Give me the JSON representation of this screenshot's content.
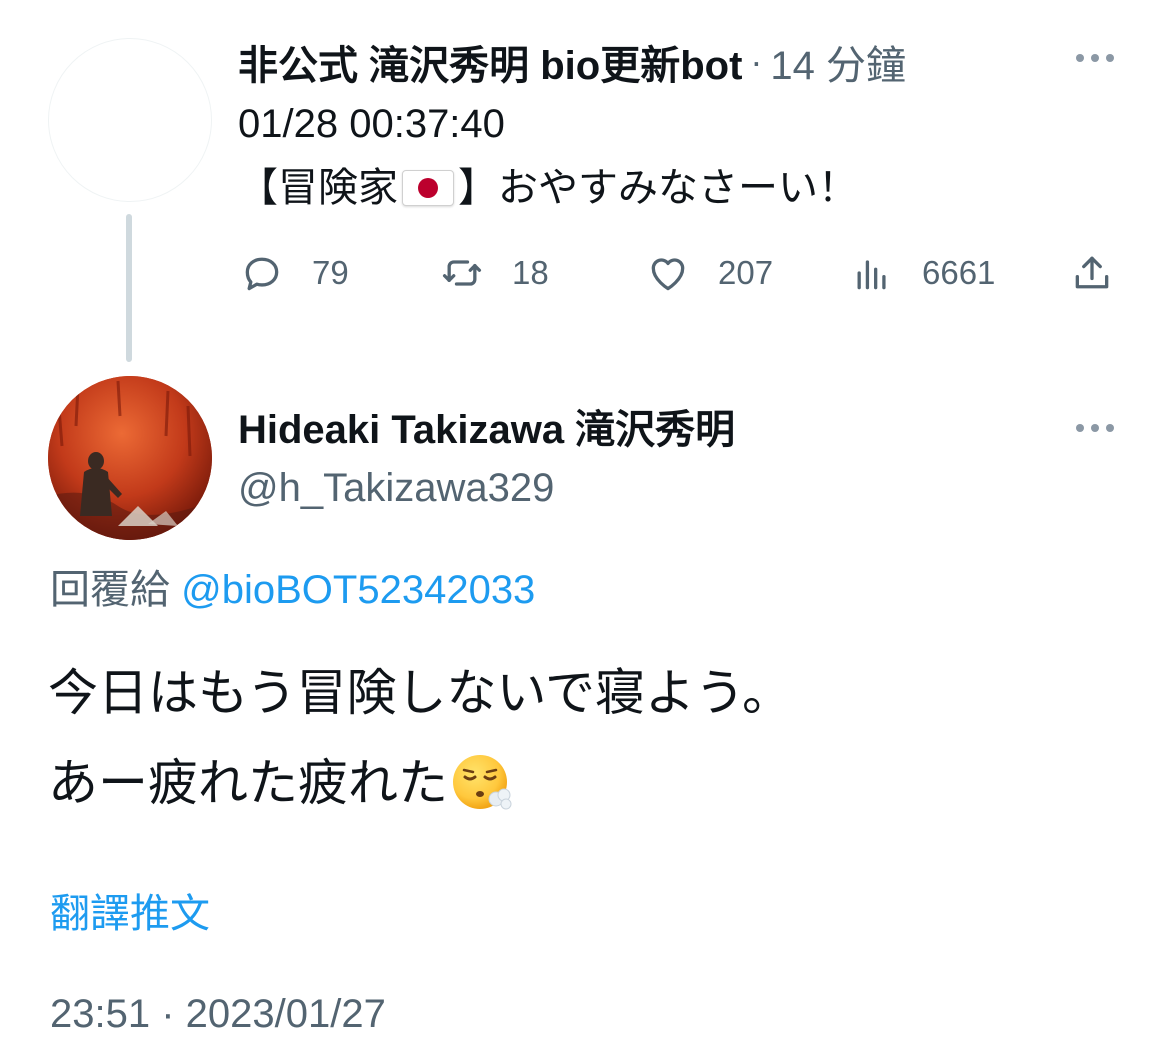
{
  "parent_tweet": {
    "author_name": "非公式 滝沢秀明 bio更新bot",
    "separator": "·",
    "time_ago": "14 分鐘",
    "text_line1": "01/28 00:37:40",
    "text_line2_prefix": "【冒険家",
    "text_line2_suffix": "】おやすみなさーい！",
    "flag_emoji": "japan-flag",
    "more_icon": "more-horizontal-icon",
    "actions": {
      "reply_count": "79",
      "retweet_count": "18",
      "like_count": "207",
      "views_count": "6661"
    }
  },
  "main_tweet": {
    "author_name": "Hideaki Takizawa 滝沢秀明",
    "author_handle": "@h_Takizawa329",
    "more_icon": "more-horizontal-icon",
    "reply_prefix": "回覆給 ",
    "reply_mention": "@bioBOT52342033",
    "body_line1": "今日はもう冒険しないで寝よう。",
    "body_line2": "あー疲れた疲れた",
    "body_emoji": "face-exhaling-emoji",
    "translate_label": "翻譯推文",
    "timestamp": "23:51 · 2023/01/27"
  },
  "colors": {
    "text_primary": "#0f1419",
    "text_secondary": "#536471",
    "accent": "#1d9bf0",
    "thread_line": "#cfd9de"
  }
}
